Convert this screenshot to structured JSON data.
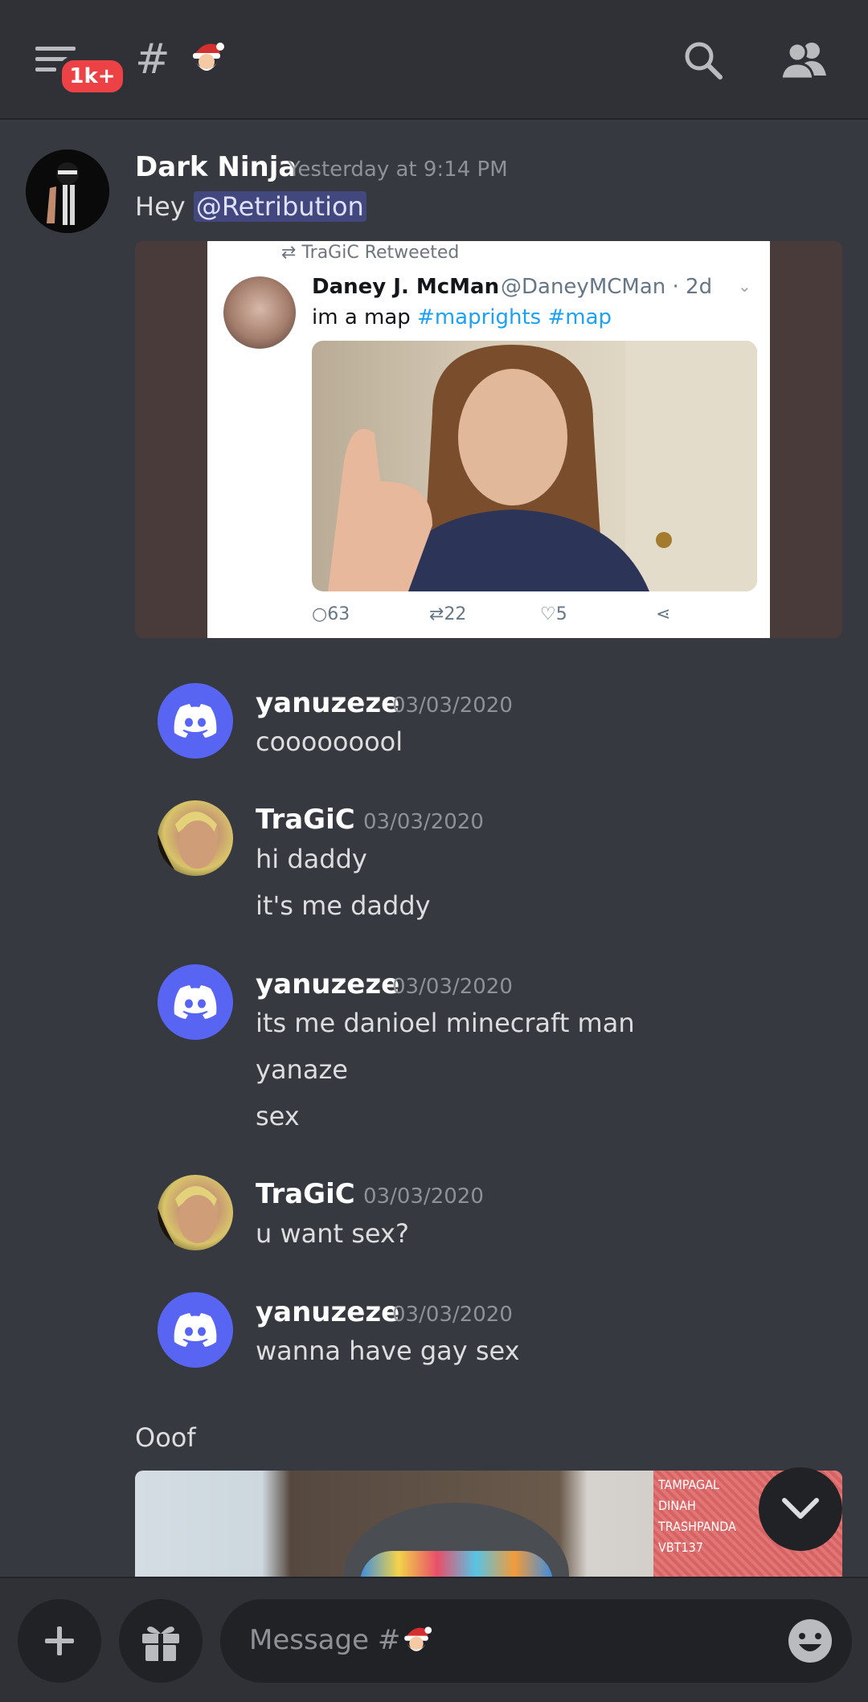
{
  "header": {
    "notification_count": "1k+",
    "channel_prefix": "#",
    "channel_emoji": "santa-emoji"
  },
  "messages": [
    {
      "author": "Dark Ninja",
      "timestamp": "Yesterday at 9:14 PM",
      "text_prefix": "Hey ",
      "mention": "@Retribution",
      "embed": {
        "retweet_label": "TraGiC Retweeted",
        "tweet_name": "Daney J. McMan",
        "tweet_handle": "@DaneyMCMan · 2d",
        "tweet_text": "im a map",
        "tweet_tag1": "#maprights",
        "tweet_tag2": "#map",
        "replies": "63",
        "retweets": "22",
        "likes": "5"
      }
    },
    {
      "author": "yanuzeze",
      "timestamp": "03/03/2020",
      "lines": [
        "cooooooool"
      ]
    },
    {
      "author": "TraGiC",
      "timestamp": "03/03/2020",
      "lines": [
        "hi daddy",
        "it's me daddy"
      ]
    },
    {
      "author": "yanuzeze",
      "timestamp": "03/03/2020",
      "lines": [
        "its me danioel minecraft man",
        "yanaze",
        "sex"
      ]
    },
    {
      "author": "TraGiC",
      "timestamp": "03/03/2020",
      "lines": [
        "u want sex?"
      ]
    },
    {
      "author": "yanuzeze",
      "timestamp": "03/03/2020",
      "lines": [
        "wanna have gay sex"
      ]
    },
    {
      "text": "Ooof",
      "embed_panel": [
        "TAMPAGAL",
        "DINAH",
        "TRASHPANDA",
        "VBT137"
      ]
    }
  ],
  "composer": {
    "placeholder": "Message #",
    "placeholder_emoji": "santa-emoji"
  }
}
